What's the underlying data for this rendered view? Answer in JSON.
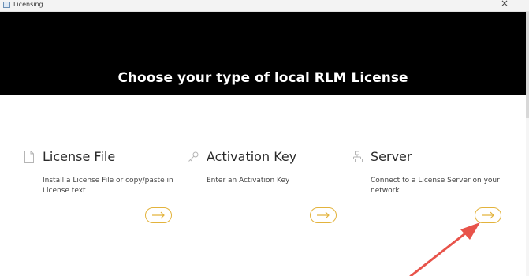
{
  "window": {
    "title": "Licensing",
    "close_glyph": "×"
  },
  "header": {
    "title": "Choose your type of local RLM License"
  },
  "cards": [
    {
      "title": "License File",
      "description": "Install a License File or copy/paste in License text",
      "icon": "file-icon",
      "action_icon": "arrow-right-icon"
    },
    {
      "title": "Activation Key",
      "description": "Enter an Activation Key",
      "icon": "key-icon",
      "action_icon": "arrow-right-icon"
    },
    {
      "title": "Server",
      "description": "Connect to a License Server on your network",
      "icon": "network-icon",
      "action_icon": "arrow-right-icon"
    }
  ],
  "colors": {
    "header_bg": "#000000",
    "accent": "#e3b33c",
    "annotation_arrow": "#e8534a"
  }
}
